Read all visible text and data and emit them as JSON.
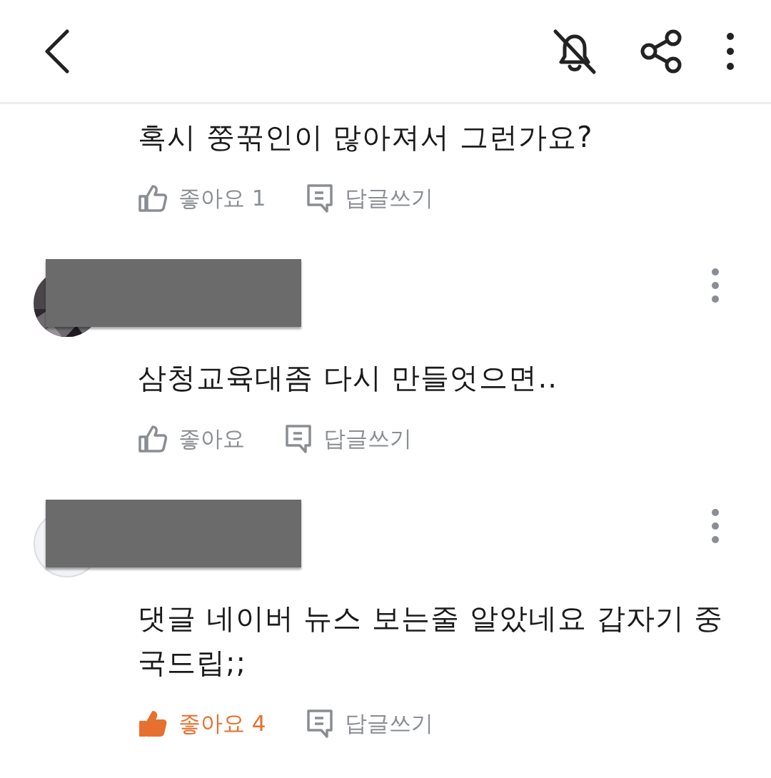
{
  "comments": [
    {
      "text": "혹시 쭝꾺인이 많아져서 그런가요?",
      "like": {
        "label": "좋아요",
        "count": "1",
        "selected": false
      },
      "reply": {
        "label": "답글쓰기"
      }
    },
    {
      "author": {
        "redacted": true
      },
      "text": "삼청교육대좀 다시 만들엇으면..",
      "like": {
        "label": "좋아요",
        "selected": false
      },
      "reply": {
        "label": "답글쓰기"
      }
    },
    {
      "author": {
        "avatar": {
          "kind": "blank"
        },
        "redacted": true
      },
      "text": "댓글 네이버 뉴스 보는줄 알았네요 갑자기 중국드립;;",
      "like": {
        "label": "좋아요",
        "count": "4",
        "selected": true
      },
      "reply": {
        "label": "답글쓰기"
      }
    }
  ]
}
